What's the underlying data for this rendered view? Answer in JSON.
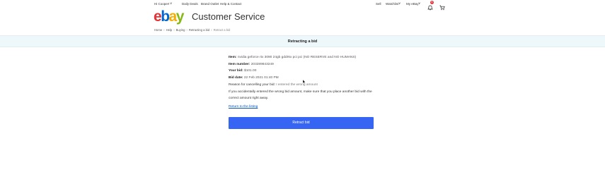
{
  "topbar": {
    "greeting": "Hi Cooper!",
    "daily_deals": "Daily Deals",
    "brand_outlet": "Brand Outlet",
    "help_contact": "Help & Contact",
    "sell": "Sell",
    "watchlist": "Watchlist",
    "my_ebay": "My eBay",
    "notification_count": "6"
  },
  "logo": {
    "letters": [
      "e",
      "b",
      "a",
      "y"
    ]
  },
  "header": {
    "title": "Customer Service"
  },
  "breadcrumb": [
    "Home",
    "Help",
    "Buying",
    "Retracting a bid",
    "Retract a bid"
  ],
  "banner": {
    "title": "Retracting a bid"
  },
  "bid": {
    "item_label": "Item:",
    "item_value": "nvidia geforce rtx 3090 24gb gddr6x pci pci (NO RESERVE and NO HUMANS)",
    "item_number_label": "Item number:",
    "item_number_value": "203289843249",
    "your_bid_label": "Your bid:",
    "your_bid_value": "$101.00",
    "bid_date_label": "Bid date:",
    "bid_date_value": "22 Feb 2021 01:40 PM",
    "reason_label": "Reason for cancelling your bid:",
    "reason_value": "I entered the wrong amount",
    "note": "If you accidentally entered the wrong bid amount, make sure that you place another bid with the correct amount right away."
  },
  "links": {
    "return_listing": "Return to the listing"
  },
  "actions": {
    "retract_bid": "Retract bid"
  },
  "colors": {
    "banner_bg": "#eef7fa",
    "primary_button": "#3665f3",
    "link": "#0654ba",
    "notification_badge": "#e53238"
  }
}
